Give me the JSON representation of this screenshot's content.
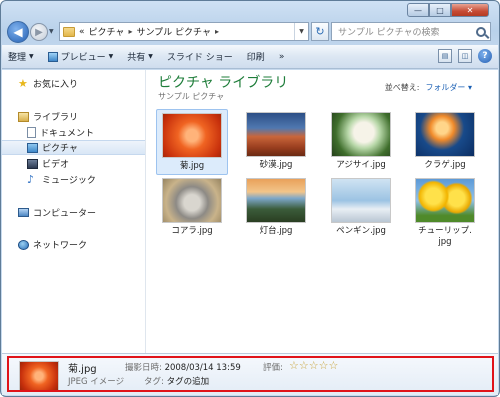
{
  "window": {
    "caption_buttons": {
      "minimize": "—",
      "maximize": "□",
      "close": "✕"
    }
  },
  "address": {
    "overflow": "«",
    "crumbs": [
      "ピクチャ",
      "サンプル ピクチャ"
    ],
    "separator": "▸"
  },
  "search": {
    "placeholder": "サンプル ピクチャの検索"
  },
  "toolbar": {
    "organize": "整理",
    "preview": "プレビュー",
    "share": "共有",
    "slideshow": "スライド ショー",
    "print": "印刷",
    "more": "»"
  },
  "sidebar": {
    "favorites": "お気に入り",
    "libraries": "ライブラリ",
    "documents": "ドキュメント",
    "pictures": "ピクチャ",
    "videos": "ビデオ",
    "music": "ミュージック",
    "computer": "コンピューター",
    "network": "ネットワーク"
  },
  "main": {
    "title": "ピクチャ ライブラリ",
    "subtitle": "サンプル ピクチャ",
    "arrange_label": "並べ替え:",
    "arrange_value": "フォルダー ▾",
    "items": [
      {
        "name": "菊.jpg",
        "thumb": "chrysanthemum"
      },
      {
        "name": "砂漠.jpg",
        "thumb": "desert"
      },
      {
        "name": "アジサイ.jpg",
        "thumb": "hydrangeas"
      },
      {
        "name": "クラゲ.jpg",
        "thumb": "jellyfish"
      },
      {
        "name": "コアラ.jpg",
        "thumb": "koala"
      },
      {
        "name": "灯台.jpg",
        "thumb": "lighthouse"
      },
      {
        "name": "ペンギン.jpg",
        "thumb": "penguins"
      },
      {
        "name": "チューリップ.",
        "name2": "jpg",
        "thumb": "tulips"
      }
    ]
  },
  "details": {
    "file_name": "菊.jpg",
    "file_type": "JPEG イメージ",
    "date_label": "撮影日時:",
    "date_value": "2008/03/14 13:59",
    "tags_label": "タグ:",
    "tags_value": "タグの追加",
    "rating_label": "評価:",
    "rating_value": 0,
    "rating_max": 5
  },
  "colors": {
    "highlight": "#e0131a",
    "library_title": "#1e7d3a",
    "link": "#1a5fb4"
  }
}
